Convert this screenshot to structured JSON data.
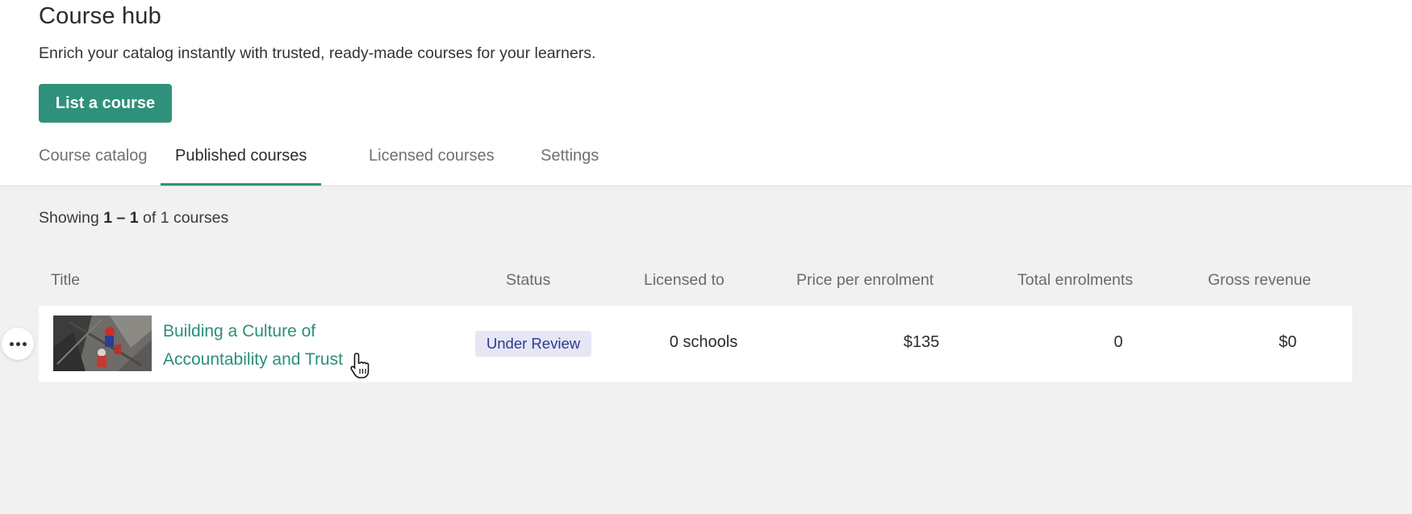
{
  "header": {
    "title": "Course hub",
    "subtitle": "Enrich your catalog instantly with trusted, ready-made courses for your learners.",
    "list_button_label": "List a course"
  },
  "tabs": [
    {
      "label": "Course catalog",
      "active": false
    },
    {
      "label": "Published courses",
      "active": true
    },
    {
      "label": "Licensed courses",
      "active": false
    },
    {
      "label": "Settings",
      "active": false
    }
  ],
  "results": {
    "prefix": "Showing ",
    "range": "1 – 1",
    "suffix": " of 1 courses"
  },
  "table": {
    "columns": [
      "Title",
      "Status",
      "Licensed to",
      "Price per enrolment",
      "Total enrolments",
      "Gross revenue"
    ],
    "rows": [
      {
        "title_line1": "Building a Culture of",
        "title_line2": "Accountability and Trust",
        "status": "Under Review",
        "licensed_to": "0 schools",
        "price": "$135",
        "total_enrolments": "0",
        "gross_revenue": "$0"
      }
    ]
  },
  "icons": {
    "row_menu": "more-horizontal-icon",
    "cursor": "hand-pointer-icon"
  },
  "colors": {
    "accent": "#2f917b",
    "link": "#2a8f7a",
    "status_bg": "#e6e6f5",
    "status_text": "#2d3a8c"
  }
}
